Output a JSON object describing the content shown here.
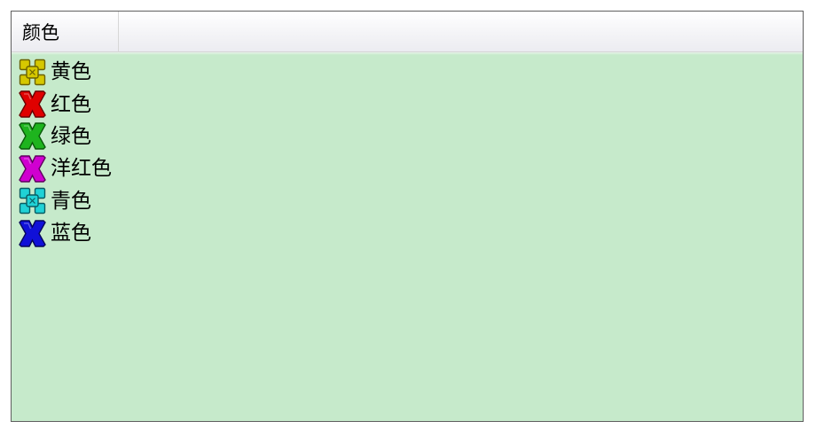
{
  "listview": {
    "background": "#c6eacb",
    "columns": [
      {
        "label": "颜色"
      }
    ],
    "items": [
      {
        "label": "黄色",
        "icon": "yellow-shape-icon",
        "color": "#d6c800",
        "dark": "#6b6200",
        "style": "outline"
      },
      {
        "label": "红色",
        "icon": "red-x-icon",
        "color": "#e00000",
        "dark": "#6a0000",
        "style": "solid"
      },
      {
        "label": "绿色",
        "icon": "green-x-icon",
        "color": "#1eb41e",
        "dark": "#0a5a0a",
        "style": "solid"
      },
      {
        "label": "洋红色",
        "icon": "magenta-x-icon",
        "color": "#d000d0",
        "dark": "#5e005e",
        "style": "solid"
      },
      {
        "label": "青色",
        "icon": "cyan-shape-icon",
        "color": "#20d2d6",
        "dark": "#0a5c62",
        "style": "outline"
      },
      {
        "label": "蓝色",
        "icon": "blue-x-icon",
        "color": "#1010d8",
        "dark": "#06065a",
        "style": "solid"
      }
    ]
  }
}
